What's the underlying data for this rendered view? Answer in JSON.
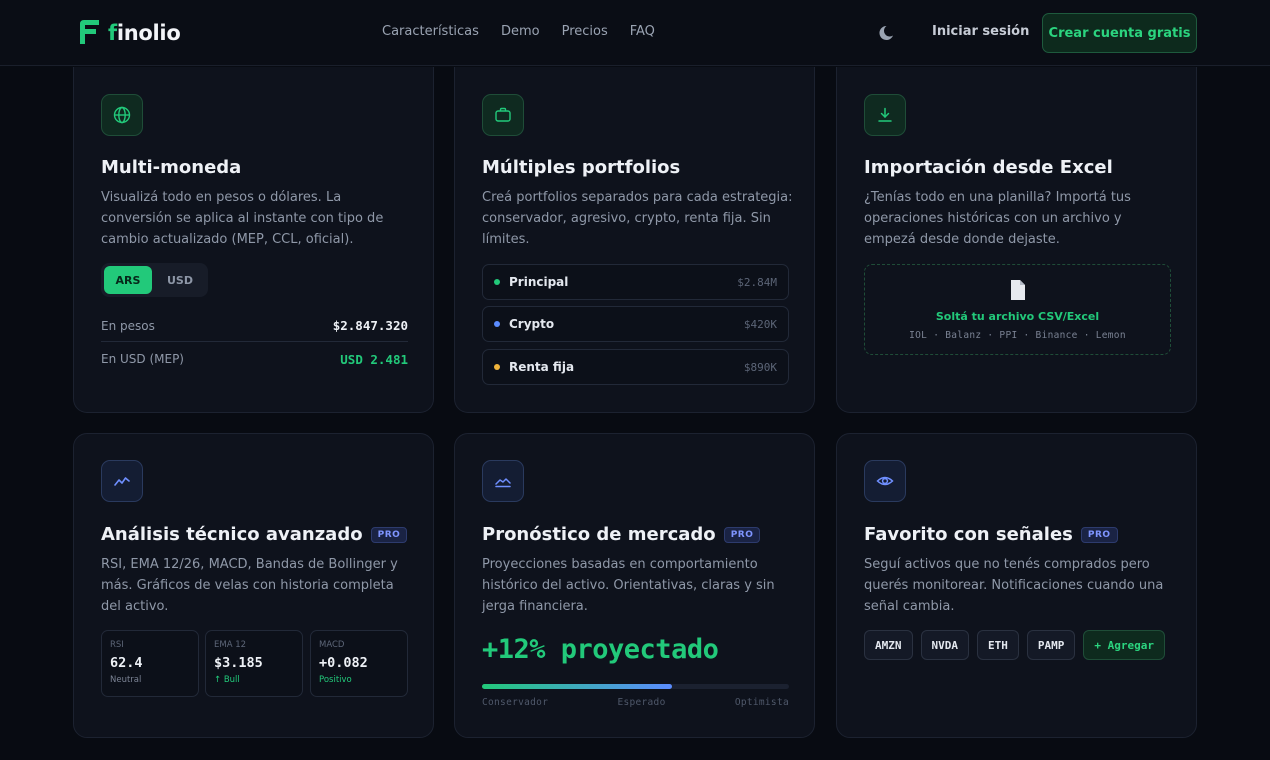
{
  "nav": {
    "logo_prefix": "f",
    "logo_rest": "inolio",
    "links": [
      "Características",
      "Demo",
      "Precios",
      "FAQ"
    ],
    "login": "Iniciar sesión",
    "cta": "Crear cuenta gratis"
  },
  "cards": {
    "multi": {
      "title": "Multi-moneda",
      "desc": "Visualizá todo en pesos o dólares. La conversión se aplica al instante con tipo de cambio actualizado (MEP, CCL, oficial).",
      "toggle": [
        "ARS",
        "USD"
      ],
      "rows": [
        {
          "label": "En pesos",
          "value": "$2.847.320"
        },
        {
          "label": "En USD (MEP)",
          "value": "USD 2.481"
        }
      ]
    },
    "portfolios": {
      "title": "Múltiples portfolios",
      "desc": "Creá portfolios separados para cada estrategia: conservador, agresivo, crypto, renta fija. Sin límites.",
      "items": [
        {
          "name": "Principal",
          "amount": "$2.84M",
          "color": "#22c97a"
        },
        {
          "name": "Crypto",
          "amount": "$420K",
          "color": "#5b8cff"
        },
        {
          "name": "Renta fija",
          "amount": "$890K",
          "color": "#f0b43c"
        }
      ]
    },
    "excel": {
      "title": "Importación desde Excel",
      "desc": "¿Tenías todo en una planilla? Importá tus operaciones históricas con un archivo y empezá desde donde dejaste.",
      "drop_title": "Soltá tu archivo CSV/Excel",
      "sources": "IOL · Balanz · PPI · Binance · Lemon"
    },
    "analysis": {
      "title": "Análisis técnico avanzado",
      "badge": "PRO",
      "desc": "RSI, EMA 12/26, MACD, Bandas de Bollinger y más. Gráficos de velas con historia completa del activo.",
      "indicators": [
        {
          "label": "RSI",
          "value": "62.4",
          "sub": "Neutral",
          "sub_color": "#7a8293"
        },
        {
          "label": "EMA 12",
          "value": "$3.185",
          "sub": "↑ Bull",
          "sub_color": "#22c97a"
        },
        {
          "label": "MACD",
          "value": "+0.082",
          "sub": "Positivo",
          "sub_color": "#22c97a"
        }
      ]
    },
    "forecast": {
      "title": "Pronóstico de mercado",
      "badge": "PRO",
      "desc": "Proyecciones basadas en comportamiento histórico del activo. Orientativas, claras y sin jerga financiera.",
      "projection": "+12% proyectado",
      "progress": 0.62,
      "scale": [
        "Conservador",
        "Esperado",
        "Optimista"
      ]
    },
    "watchlist": {
      "title": "Favorito con señales",
      "badge": "PRO",
      "desc": "Seguí activos que no tenés comprados pero querés monitorear. Notificaciones cuando una señal cambia.",
      "chips": [
        "AMZN",
        "NVDA",
        "ETH",
        "PAMP"
      ],
      "add": "+ Agregar"
    }
  },
  "colors": {
    "accent": "#22c97a",
    "blue": "#5b8cff",
    "background": "#080b12",
    "card": "#0e121c"
  }
}
